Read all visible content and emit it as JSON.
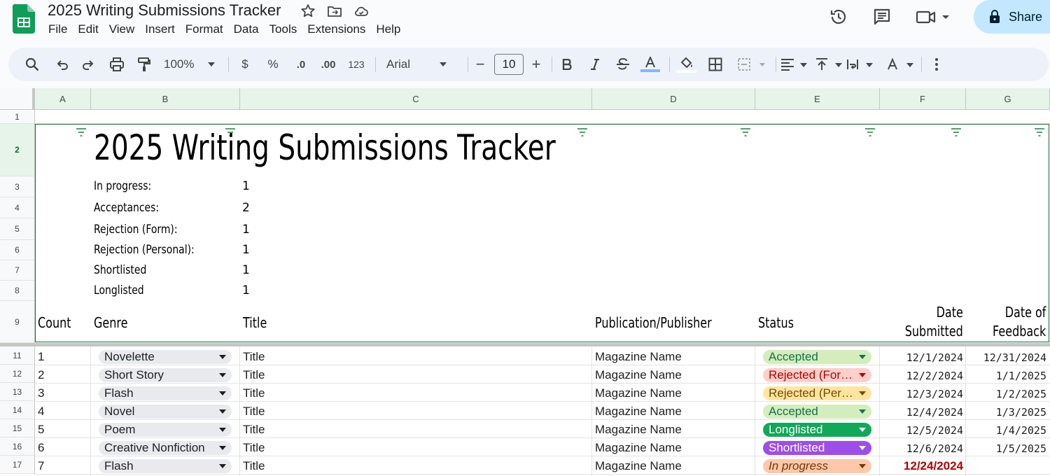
{
  "document": {
    "title": "2025 Writing Submissions Tracker"
  },
  "menu": [
    "File",
    "Edit",
    "View",
    "Insert",
    "Format",
    "Data",
    "Tools",
    "Extensions",
    "Help"
  ],
  "share_label": "Share",
  "toolbar": {
    "zoom": "100%",
    "currency": "$",
    "percent": "%",
    "dec_decrease": ".0",
    "dec_increase": ".00",
    "number_format": "123",
    "font": "Arial",
    "font_size": "10"
  },
  "columns": [
    "A",
    "B",
    "C",
    "D",
    "E",
    "F",
    "G"
  ],
  "rows": [
    "1",
    "2",
    "3",
    "4",
    "5",
    "6",
    "7",
    "8",
    "9",
    "11",
    "12",
    "13",
    "14",
    "15",
    "16",
    "17"
  ],
  "sheet": {
    "title": "2025 Writing Submissions Tracker",
    "summary": [
      {
        "label": "In progress:",
        "value": "1"
      },
      {
        "label": "Acceptances:",
        "value": "2"
      },
      {
        "label": "Rejection (Form):",
        "value": "1"
      },
      {
        "label": "Rejection (Personal):",
        "value": "1"
      },
      {
        "label": "Shortlisted",
        "value": "1"
      },
      {
        "label": "Longlisted",
        "value": "1"
      }
    ],
    "headers": {
      "count": "Count",
      "genre": "Genre",
      "title": "Title",
      "publication": "Publication/Publisher",
      "status": "Status",
      "date_submitted_1": "Date",
      "date_submitted_2": "Submitted",
      "date_feedback_1": "Date of",
      "date_feedback_2": "Feedback"
    },
    "entries": [
      {
        "count": "1",
        "genre": "Novelette",
        "title": "Title",
        "publication": "Magazine Name",
        "status": "Accepted",
        "submitted": "12/1/2024",
        "feedback": "12/31/2024"
      },
      {
        "count": "2",
        "genre": "Short Story",
        "title": "Title",
        "publication": "Magazine Name",
        "status": "Rejected (For…",
        "submitted": "12/2/2024",
        "feedback": "1/1/2025"
      },
      {
        "count": "3",
        "genre": "Flash",
        "title": "Title",
        "publication": "Magazine Name",
        "status": "Rejected (Per…",
        "submitted": "12/3/2024",
        "feedback": "1/2/2025"
      },
      {
        "count": "4",
        "genre": "Novel",
        "title": "Title",
        "publication": "Magazine Name",
        "status": "Accepted",
        "submitted": "12/4/2024",
        "feedback": "1/3/2025"
      },
      {
        "count": "5",
        "genre": "Poem",
        "title": "Title",
        "publication": "Magazine Name",
        "status": "Longlisted",
        "submitted": "12/5/2024",
        "feedback": "1/4/2025"
      },
      {
        "count": "6",
        "genre": "Creative Nonfiction",
        "title": "Title",
        "publication": "Magazine Name",
        "status": "Shortlisted",
        "submitted": "12/6/2024",
        "feedback": "1/5/2025"
      },
      {
        "count": "7",
        "genre": "Flash",
        "title": "Title",
        "publication": "Magazine Name",
        "status": "In progress",
        "submitted": "12/24/2024",
        "feedback": ""
      }
    ]
  },
  "colors": {
    "accent": "#188038",
    "chip_accepted": "#d4edbc",
    "chip_rejected_form": "#ffcfc9",
    "chip_rejected_personal": "#ffe5a0",
    "chip_longlisted": "#11734b",
    "chip_shortlisted": "#5a3286",
    "chip_in_progress": "#ffc8aa",
    "overdue_date": "#b10202"
  }
}
